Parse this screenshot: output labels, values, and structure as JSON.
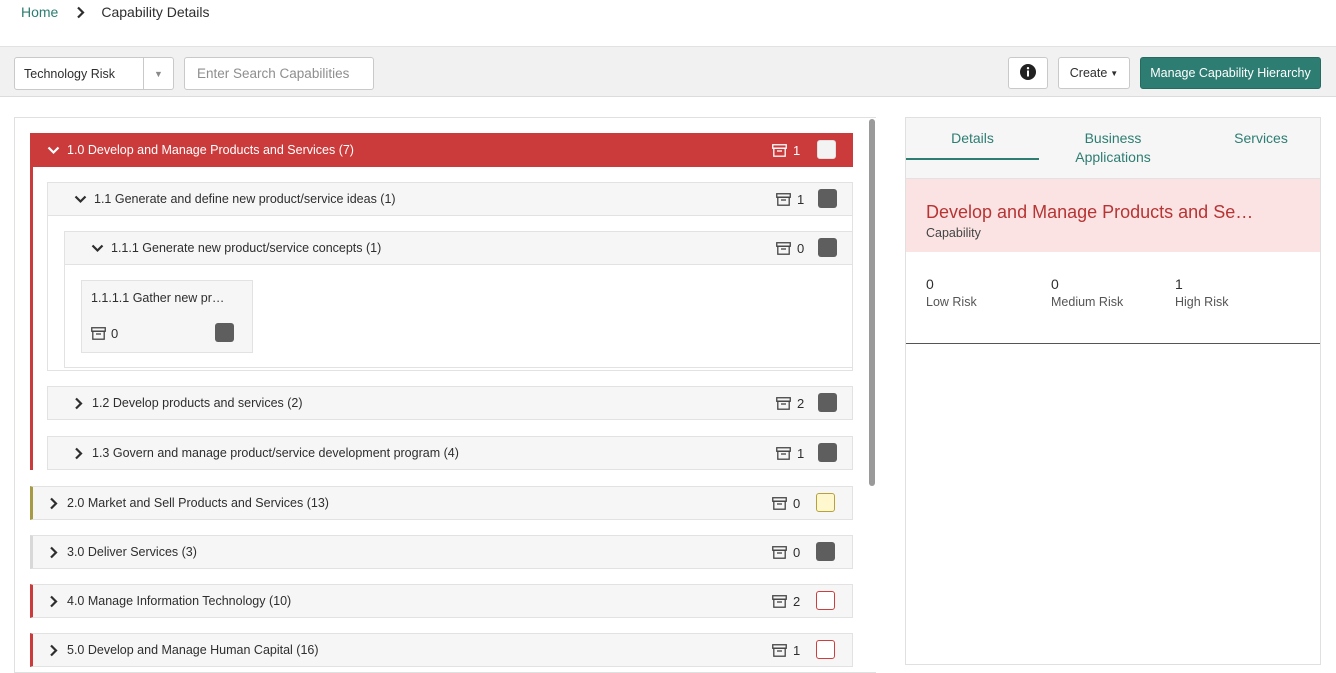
{
  "breadcrumb": {
    "home": "Home",
    "current": "Capability Details"
  },
  "toolbar": {
    "select_value": "Technology Risk",
    "search_placeholder": "Enter Search Capabilities",
    "create_label": "Create",
    "manage_label": "Manage Capability Hierarchy"
  },
  "tree": {
    "l1_0": {
      "label": "1.0 Develop and Manage Products and Services (7)",
      "count": "1"
    },
    "l1_1": {
      "label": "1.1 Generate and define new product/service ideas (1)",
      "count": "1"
    },
    "l1_1_1": {
      "label": "1.1.1 Generate new product/service concepts (1)",
      "count": "0"
    },
    "card": {
      "label": "1.1.1.1 Gather new pr…",
      "count": "0"
    },
    "l1_2": {
      "label": "1.2 Develop products and services (2)",
      "count": "2"
    },
    "l1_3": {
      "label": "1.3 Govern and manage product/service development program (4)",
      "count": "1"
    },
    "l2_0": {
      "label": "2.0 Market and Sell Products and Services (13)",
      "count": "0"
    },
    "l3_0": {
      "label": "3.0 Deliver Services (3)",
      "count": "0"
    },
    "l4_0": {
      "label": "4.0 Manage Information Technology (10)",
      "count": "2"
    },
    "l5_0": {
      "label": "5.0 Develop and Manage Human Capital (16)",
      "count": "1"
    }
  },
  "details": {
    "tabs": [
      "Details",
      "Business Applications",
      "Services"
    ],
    "tab_business_line1": "Business",
    "tab_business_line2": "Applications",
    "name": "Develop and Manage Products and Se…",
    "type": "Capability",
    "stats": [
      {
        "value": "0",
        "label": "Low Risk"
      },
      {
        "value": "0",
        "label": "Medium Risk"
      },
      {
        "value": "1",
        "label": "High Risk"
      }
    ]
  },
  "colors": {
    "accent": "#2d7d72",
    "risk_high": "#cc3b3b",
    "risk_medium": "#b7a23a"
  }
}
